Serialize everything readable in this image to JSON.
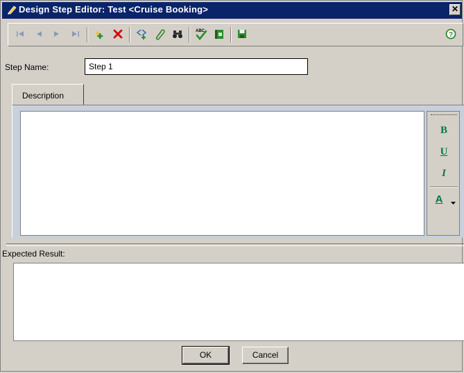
{
  "window": {
    "title": "Design Step Editor: Test <Cruise Booking>",
    "close_glyph": "✕"
  },
  "toolbar": {
    "buttons": [
      {
        "name": "first-step",
        "icon": "first-icon",
        "tooltip": "First Step"
      },
      {
        "name": "previous-step",
        "icon": "previous-icon",
        "tooltip": "Previous Step"
      },
      {
        "name": "next-step",
        "icon": "next-icon",
        "tooltip": "Next Step"
      },
      {
        "name": "last-step",
        "icon": "last-icon",
        "tooltip": "Last Step"
      },
      {
        "name": "new-step",
        "icon": "new-step-icon",
        "tooltip": "New Step"
      },
      {
        "name": "delete-step",
        "icon": "delete-icon",
        "tooltip": "Delete Step"
      },
      {
        "name": "insert-parameter",
        "icon": "parameter-icon",
        "tooltip": "Insert Parameter"
      },
      {
        "name": "attachments",
        "icon": "paperclip-icon",
        "tooltip": "Attachments"
      },
      {
        "name": "find",
        "icon": "binoculars-icon",
        "tooltip": "Find"
      },
      {
        "name": "spelling",
        "icon": "spell-check-icon",
        "tooltip": "Check Spelling"
      },
      {
        "name": "thesaurus",
        "icon": "book-icon",
        "tooltip": "Thesaurus"
      },
      {
        "name": "save",
        "icon": "save-icon",
        "tooltip": "Save"
      },
      {
        "name": "help",
        "icon": "help-icon",
        "tooltip": "Help"
      }
    ]
  },
  "form": {
    "step_name_label": "Step Name:",
    "step_name_value": "Step 1",
    "description_tab": "Description",
    "description_text": "",
    "expected_result_label": "Expected Result:",
    "expected_result_text": ""
  },
  "formatting": {
    "bold": "B",
    "underline": "U",
    "italic": "I",
    "font_color": "A"
  },
  "buttons": {
    "ok": "OK",
    "cancel": "Cancel"
  },
  "colors": {
    "title_bar": "#0a246a",
    "format_green": "#007a3d",
    "delete_red": "#d40000"
  }
}
